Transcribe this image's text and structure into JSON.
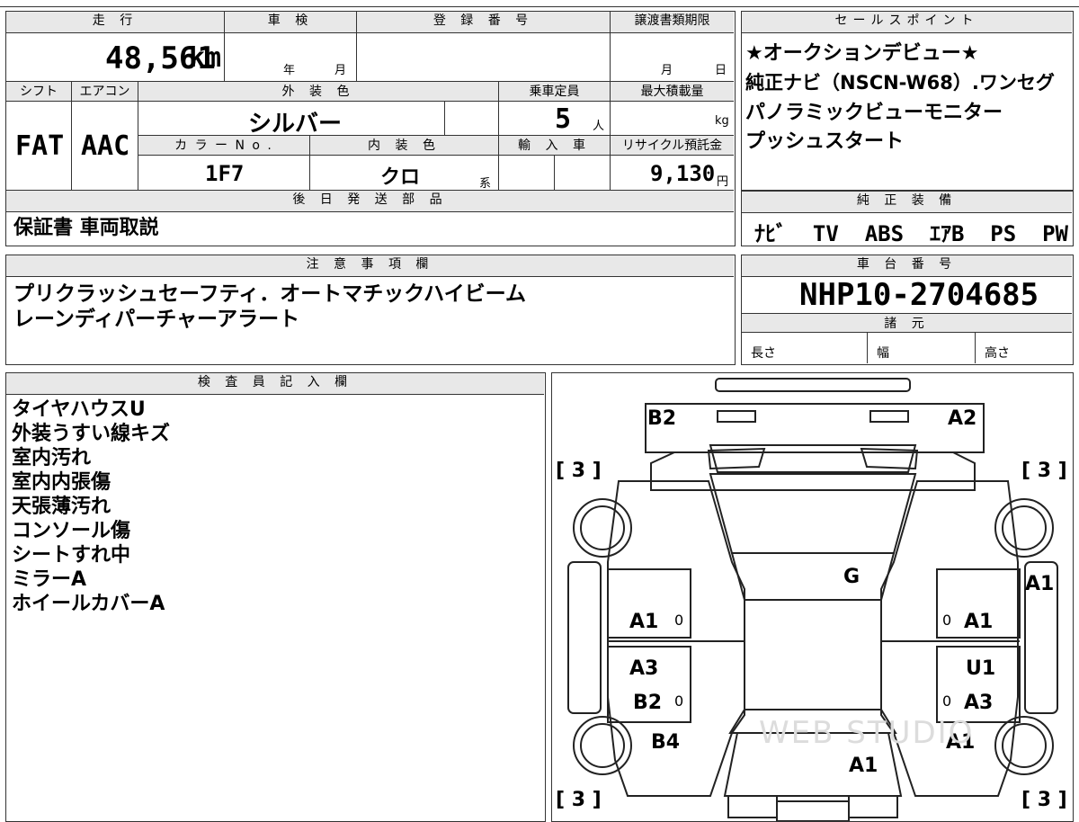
{
  "top": {
    "mileage_label": "走 行",
    "mileage_value": "48,561",
    "mileage_unit": "km",
    "shaken_label": "車 検",
    "shaken_year": "年",
    "shaken_month": "月",
    "reg_label": "登 録 番 号",
    "transfer_label": "譲渡書類期限",
    "transfer_month": "月",
    "transfer_day": "日",
    "shift_label": "シフト",
    "shift_value": "FAT",
    "aircon_label": "エアコン",
    "aircon_value": "AAC",
    "exterior_label": "外 装 色",
    "exterior_value": "シルバー",
    "capacity_label": "乗車定員",
    "capacity_value": "5",
    "capacity_unit": "人",
    "maxload_label": "最大積載量",
    "maxload_unit": "kg",
    "color_no_label": "カ ラ ー N o .",
    "color_no_value": "1F7",
    "interior_label": "内 装 色",
    "interior_value": "クロ",
    "interior_suffix": "系",
    "import_label": "輸 入 車",
    "recycle_label": "リサイクル預託金",
    "recycle_value": "9,130",
    "recycle_unit": "円",
    "later_label": "後 日 発 送 部 品",
    "later_value": "保証書 車両取説"
  },
  "sales": {
    "label": "セールスポイント",
    "lines": [
      "★オークションデビュー★",
      "純正ナビ（NSCN-W68）.ワンセグ",
      "パノラミックビューモニター",
      "プッシュスタート"
    ]
  },
  "equipment": {
    "label": "純 正 装 備",
    "value": "ﾅﾋﾞ  TV  ABS  ｴｱB  PS  PW"
  },
  "notes": {
    "label": "注 意 事 項 欄",
    "lines": [
      "プリクラッシュセーフティ．オートマチックハイビーム",
      "レーンディパーチャーアラート"
    ]
  },
  "chassis": {
    "label": "車 台 番 号",
    "value": "NHP10-2704685",
    "spec_label": "諸 元",
    "length_label": "長さ",
    "width_label": "幅",
    "height_label": "高さ"
  },
  "inspector": {
    "label": "検 査 員 記 入 欄",
    "lines": [
      "タイヤハウスU",
      "外装うすい線キズ",
      "室内汚れ",
      "室内内張傷",
      "天張薄汚れ",
      "コンソール傷",
      "シートすれ中",
      "ミラーA",
      "ホイールカバーA"
    ]
  },
  "diagram": {
    "marks": {
      "b2_top": "B2",
      "a2_top": "A2",
      "g": "G",
      "a1_side": "A1",
      "a1_fl": "A1",
      "a1_fr": "A1",
      "a3_l": "A3",
      "u1_r": "U1",
      "b2_l": "B2",
      "a3_r": "A3",
      "b4_l": "B4",
      "a1_rr": "A1",
      "a1_rear": "A1"
    },
    "tires": {
      "fl": "[ 3 ]",
      "fr": "[ 3 ]",
      "rl": "[ 3 ]",
      "rr": "[ 3 ]"
    },
    "zero": "0",
    "watermark": "WEB STUDIO"
  }
}
